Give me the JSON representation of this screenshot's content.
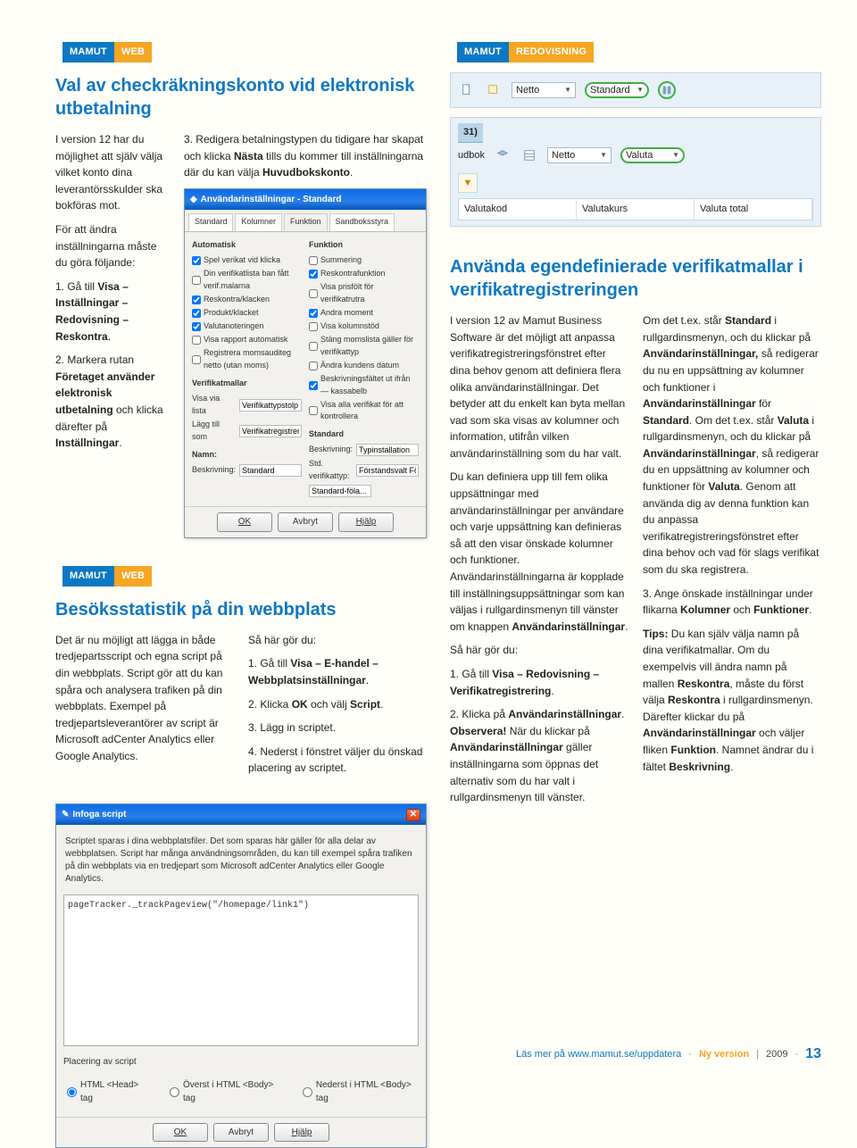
{
  "left": {
    "section1": {
      "tag_a": "MAMUT",
      "tag_b": "WEB",
      "title": "Val av checkräkningskonto vid elektronisk utbetalning",
      "col1": {
        "intro": "I version 12 har du möjlighet att själv välja vilket konto dina leverantörsskulder ska bokföras mot.",
        "lead": "För att ändra inställningarna måste du göra följande:",
        "step1_pre": "1. Gå till ",
        "step1_b1": "Visa – Inställningar – Redovisning – Reskontra",
        "step1_post": ".",
        "step2_pre": "2. Markera rutan ",
        "step2_b1": "Företaget använder elektronisk utbetalning",
        "step2_mid": " och klicka därefter på ",
        "step2_b2": "Inställningar",
        "step2_post": "."
      },
      "col2": {
        "step3_pre": "3. Redigera betalningstypen du tidigare har skapat och klicka ",
        "step3_b1": "Nästa",
        "step3_mid": " tills du kommer till inställningarna där du kan välja ",
        "step3_b2": "Huvudbokskonto",
        "step3_post": "."
      }
    },
    "settings_dialog": {
      "title": "Användarinställningar - Standard",
      "tabs": [
        "Standard",
        "Kolumner",
        "Funktion",
        "Sandboksstyra"
      ],
      "left_label": "Automatisk",
      "left_checks": [
        "Spel verikat vid klicka",
        "Din verifikatlista ban fått verif.malarna",
        "Reskontra/klacken",
        "Produkt/klacket",
        "Valutanoteringen",
        "Visa rapport automatisk",
        "Registrera momsauditeg netto (utan moms)"
      ],
      "verif_label": "Verifikatmallar",
      "row1a": "Visa via lista",
      "row1b": "Verifikattypstolp",
      "row2a": "Lägg till som",
      "row2b": "Verifikatregistrering",
      "right_label": "Funktion",
      "right_checks": [
        "Summering",
        "Reskontrafunktion",
        "Visa prisfölt för verifikatrutra",
        "Andra moment",
        "Visa kolumnstöd",
        "Stäng momslista gäller för verifikattyp",
        "Ändra kundens datum",
        "Beskrivningsfältet ut ifrån — kassabelb",
        "Visa alla verifikat för att kontrollera"
      ],
      "std_label": "Standard",
      "std_row1a": "Beskrivning:",
      "std_row1b": "Typinstallation",
      "std_row2a": "Std. verifikattyp:",
      "std_row2b": "Förstandsvalt Föl...",
      "std_row3": "Standard-föla...",
      "namn_label": "Namn:",
      "namn_row": "Beskrivning:",
      "namn_val": "Standard",
      "buttons": {
        "ok": "OK",
        "cancel": "Avbryt",
        "help": "Hjälp"
      }
    },
    "section2": {
      "tag_a": "MAMUT",
      "tag_b": "WEB",
      "title": "Besöksstatistik på din webbplats",
      "col1": "Det är nu möjligt att lägga in både tredjepartsscript och egna script på din webbplats. Script gör att du kan spåra och analysera trafiken på din webbplats. Exempel på tredjepartsleverantörer av script är Microsoft adCenter Analytics eller Google Analytics.",
      "col2": {
        "lead": "Så här gör du:",
        "l1_pre": "1. Gå till ",
        "l1_b": "Visa – E-handel – Webbplatsinställningar",
        "l1_post": ".",
        "l2_pre": "2. Klicka ",
        "l2_b1": "OK",
        "l2_mid": " och välj ",
        "l2_b2": "Script",
        "l2_post": ".",
        "l3": "3. Lägg in scriptet.",
        "l4": "4. Nederst i fönstret väljer du önskad placering av scriptet."
      }
    },
    "script_dialog": {
      "title": "Infoga script",
      "desc": "Scriptet sparas i dina webbplatsfiler. Det som sparas här gäller för alla delar av webbplatsen. Script har många användningsområden, du kan till exempel spåra trafiken på din webbplats via en tredjepart som Microsoft adCenter Analytics eller Google Analytics.",
      "code_line": "pageTracker._trackPageview(\"/homepage/link1\")",
      "placement": "Placering av script",
      "r1": "HTML <Head> tag",
      "r2": "Överst i HTML <Body> tag",
      "r3": "Nederst i HTML <Body> tag",
      "buttons": {
        "ok": "OK",
        "cancel": "Avbryt",
        "help": "Hjälp"
      }
    }
  },
  "right": {
    "tag_a": "MAMUT",
    "tag_b": "REDOVISNING",
    "bar1": {
      "sel1": "Netto",
      "sel2": "Standard"
    },
    "bar2": {
      "label31": "31)",
      "row1a": "udbok",
      "sel1": "Netto",
      "sel2": "Valuta",
      "th": [
        "Valutakod",
        "Valutakurs",
        "Valuta total"
      ]
    },
    "title": "Använda egendefinierade verifikatmallar i verifikatregistreringen",
    "col1": {
      "p1": "I version 12 av Mamut Business Software är det möjligt att anpassa verifikatregistreringsfönstret efter dina behov genom att definiera flera olika användarinställningar. Det betyder att du enkelt kan byta mellan vad som ska visas av kolumner och information, utifrån vilken användarinställning som du har valt.",
      "p2_pre": "Du kan definiera upp till fem olika uppsättningar med användarinställningar per användare och varje uppsättning kan definieras så att den visar önskade kolumner och funktioner. Användarinställningarna är kopplade till inställningsuppsättningar som kan väljas i rullgardinsmenyn till vänster om knappen ",
      "p2_b": "Användarinställningar",
      "p2_post": ".",
      "lead": "Så här gör du:",
      "s1_pre": "1. Gå till ",
      "s1_b": "Visa – Redovisning – Verifikatregistrering",
      "s1_post": ".",
      "s2_pre": "2. Klicka på ",
      "s2_b1": "Användarinställningar",
      "s2_mid1": ". ",
      "s2_b2": "Observera!",
      "s2_mid2": " När du klickar på ",
      "s2_b3": "Användarinställningar",
      "s2_post": " gäller inställningarna som öppnas det alternativ som du har valt i rullgardinsmenyn till vänster."
    },
    "col2": {
      "p1_pre": "Om det t.ex. står ",
      "p1_b1": "Standard",
      "p1_mid1": " i rullgardinsmenyn, och du klickar på ",
      "p1_b2": "Användarinställningar,",
      "p1_mid2": " så redigerar du nu en uppsättning av kolumner och funktioner i ",
      "p1_b3": "Användarinställningar",
      "p1_mid3": " för ",
      "p1_b4": "Standard",
      "p1_mid4": ". Om det t.ex. står ",
      "p1_b5": "Valuta",
      "p1_mid5": " i rullgardinsmenyn, och du klickar på ",
      "p1_b6": "Användarinställningar",
      "p1_mid6": ", så redigerar du en uppsättning av kolumner och funktioner för ",
      "p1_b7": "Valuta",
      "p1_post": ". Genom att använda dig av denna funktion kan du anpassa verifikatregistreringsfönstret efter dina behov och vad för slags verifikat som du ska registrera.",
      "s3_pre": "3. Ange önskade inställningar under flikarna ",
      "s3_b1": "Kolumner",
      "s3_mid": " och ",
      "s3_b2": "Funktioner",
      "s3_post": ".",
      "tips_lead": "Tips:",
      "tips_pre": " Du kan själv välja namn på dina verifikatmallar. Om du exempelvis vill ändra namn på mallen ",
      "tips_b1": "Reskontra",
      "tips_mid1": ", måste du först välja ",
      "tips_b2": "Reskontra",
      "tips_mid2": " i rullgardinsmenyn. Därefter klickar du på ",
      "tips_b3": "Användarinställningar",
      "tips_mid3": " och väljer fliken ",
      "tips_b4": "Funktion",
      "tips_mid4": ". Namnet ändrar du i fältet ",
      "tips_b5": "Beskrivning",
      "tips_post": "."
    }
  },
  "footer": {
    "left": "Läs mer på www.mamut.se/uppdatera",
    "mid": "Ny version",
    "year": "2009",
    "page": "13"
  }
}
